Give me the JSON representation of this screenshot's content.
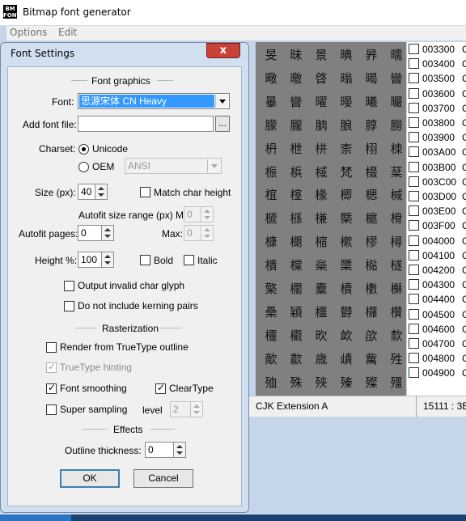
{
  "app": {
    "icon_text": "BM FONT",
    "title": "Bitmap font generator"
  },
  "menu": [
    "Options",
    "Edit"
  ],
  "dialog": {
    "title": "Font Settings",
    "close_glyph": "x",
    "font_graphics_heading": "Font graphics",
    "font_label": "Font:",
    "font_value": "思源宋体 CN Heavy",
    "add_font_label": "Add font file:",
    "add_font_value": "",
    "browse_label": "...",
    "charset_label": "Charset:",
    "unicode_label": "Unicode",
    "oem_label": "OEM",
    "oem_value": "ANSI",
    "size_label": "Size (px):",
    "size_value": "40",
    "match_height_label": "Match char height",
    "autofit_range_label": "Autofit size range (px) Min:",
    "autofit_min_value": "0",
    "autofit_pages_label": "Autofit pages:",
    "autofit_pages_value": "0",
    "max_label": "Max:",
    "max_value": "0",
    "height_pct_label": "Height %:",
    "height_pct_value": "100",
    "bold_label": "Bold",
    "italic_label": "Italic",
    "output_invalid_label": "Output invalid char glyph",
    "no_kerning_label": "Do not include kerning pairs",
    "rasterization_heading": "Rasterization",
    "render_truetype_label": "Render from TrueType outline",
    "truetype_hinting_label": "TrueType hinting",
    "font_smoothing_label": "Font smoothing",
    "cleartype_label": "ClearType",
    "super_sampling_label": "Super sampling",
    "level_label": "level",
    "level_value": "2",
    "effects_heading": "Effects",
    "outline_label": "Outline thickness:",
    "outline_value": "0",
    "ok_label": "OK",
    "cancel_label": "Cancel",
    "states": {
      "unicode": true,
      "oem": false,
      "match_height": false,
      "bold": false,
      "italic": false,
      "output_invalid": false,
      "no_kerning": false,
      "render_truetype": false,
      "truetype_hinting": true,
      "font_smoothing": true,
      "cleartype": true,
      "super_sampling": false
    }
  },
  "grid": {
    "rows": [
      [
        "旻",
        "昧",
        "景",
        "晪",
        "昦",
        "曘"
      ],
      [
        "曔",
        "曒",
        "晵",
        "暡",
        "暍",
        "曫"
      ],
      [
        "曓",
        "曫",
        "曜",
        "暥",
        "曦",
        "曮"
      ],
      [
        "朦",
        "朧",
        "朒",
        "朖",
        "朜",
        "朥"
      ],
      [
        "枬",
        "枻",
        "栟",
        "柰",
        "栩",
        "栜"
      ],
      [
        "桭",
        "梹",
        "棫",
        "梵",
        "棳",
        "棻"
      ],
      [
        "椬",
        "榁",
        "椽",
        "楖",
        "楒",
        "椷"
      ],
      [
        "榹",
        "槂",
        "槏",
        "槩",
        "槴",
        "榾"
      ],
      [
        "槺",
        "樃",
        "樎",
        "樕",
        "樛",
        "樳"
      ],
      [
        "樻",
        "橖",
        "橤",
        "檃",
        "檆",
        "檖"
      ],
      [
        "檠",
        "櫊",
        "櫜",
        "櫝",
        "櫢",
        "櫯"
      ],
      [
        "櫐",
        "穎",
        "櫮",
        "欎",
        "欏",
        "欑"
      ],
      [
        "欞",
        "欟",
        "欥",
        "欰",
        "欿",
        "歀"
      ],
      [
        "歒",
        "歗",
        "歳",
        "歵",
        "歶",
        "殅"
      ],
      [
        "殈",
        "殊",
        "殎",
        "殝",
        "殩",
        "殭"
      ]
    ]
  },
  "codes": [
    "003300",
    "003400",
    "003500",
    "003600",
    "003700",
    "003800",
    "003900",
    "003A00",
    "003B00",
    "003C00",
    "003D00",
    "003E00",
    "003F00",
    "004000",
    "004100",
    "004200",
    "004300",
    "004400",
    "004500",
    "004600",
    "004700",
    "004800",
    "004900"
  ],
  "code_suffix": "C",
  "status": {
    "range": "CJK  Extension A",
    "count": "15111 : 3B"
  }
}
